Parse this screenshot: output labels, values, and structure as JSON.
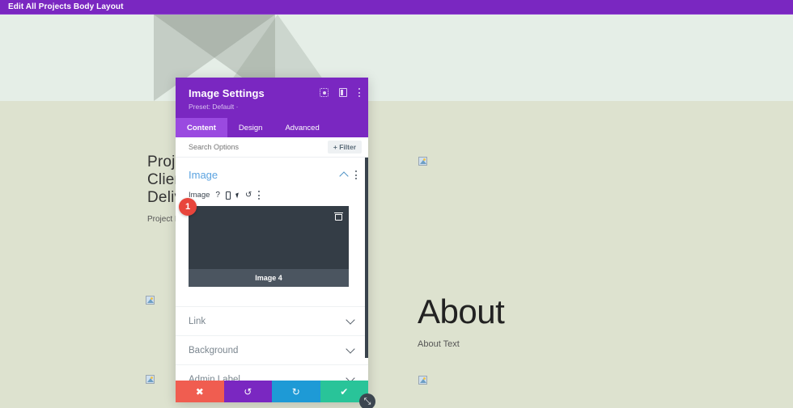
{
  "topbar": {
    "title": "Edit All Projects Body Layout"
  },
  "page": {
    "project": {
      "heading_line1": "Projec",
      "heading_line2": "Client",
      "heading_line3": "Delive",
      "subtext": "Project I"
    },
    "about": {
      "heading": "About",
      "subtext": "About Text"
    },
    "placeholders": [
      {
        "name": "broken-image-left-top"
      },
      {
        "name": "broken-image-left-bottom"
      },
      {
        "name": "broken-image-right-top"
      },
      {
        "name": "broken-image-right-bottom"
      }
    ]
  },
  "modal": {
    "title": "Image Settings",
    "preset": "Preset: Default ·",
    "header_icons": [
      {
        "name": "expand-icon"
      },
      {
        "name": "split-view-icon"
      },
      {
        "name": "more-options-icon"
      }
    ],
    "tabs": [
      {
        "label": "Content",
        "active": true
      },
      {
        "label": "Design",
        "active": false
      },
      {
        "label": "Advanced",
        "active": false
      }
    ],
    "search": {
      "placeholder": "Search Options",
      "value": ""
    },
    "filter_button": "+ Filter",
    "section": {
      "title": "Image",
      "field_label": "Image",
      "field_icons": [
        {
          "name": "help-icon",
          "glyph": "?"
        },
        {
          "name": "responsive-icon"
        },
        {
          "name": "hover-cursor-icon"
        },
        {
          "name": "reset-icon",
          "glyph": "↺"
        },
        {
          "name": "field-options-icon"
        }
      ],
      "preview": {
        "caption": "Image 4",
        "badge": "1",
        "delete_icon": "trash-icon"
      }
    },
    "accordions": [
      {
        "label": "Link"
      },
      {
        "label": "Background"
      },
      {
        "label": "Admin Label"
      }
    ],
    "actions": [
      {
        "name": "cancel-button",
        "glyph": "✖",
        "color": "#f05d50"
      },
      {
        "name": "undo-button",
        "glyph": "↺",
        "color": "#7a27c1"
      },
      {
        "name": "redo-button",
        "glyph": "↻",
        "color": "#1e9ad6"
      },
      {
        "name": "save-button",
        "glyph": "✔",
        "color": "#29c499"
      }
    ],
    "resize_handle": "⤡"
  },
  "colors": {
    "brand_purple": "#7a27c1",
    "tab_active": "#9a4ae0",
    "section_title_blue": "#5ba3e0",
    "badge_red": "#e8453c",
    "save_green": "#29c499",
    "page_top_bg": "#e5eee7",
    "page_bottom_bg": "#dde2cf"
  }
}
